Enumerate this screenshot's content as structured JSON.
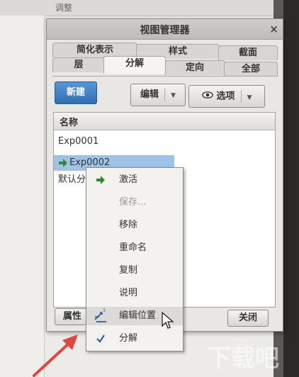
{
  "background": {
    "partial_title": "调整"
  },
  "dialog": {
    "title": "视图管理器",
    "close_glyph": "×",
    "tabs_row1": [
      {
        "label": "简化表示"
      },
      {
        "label": "样式"
      },
      {
        "label": "截面"
      }
    ],
    "tabs_row2": [
      {
        "label": "层"
      },
      {
        "label": "分解"
      },
      {
        "label": "定向"
      },
      {
        "label": "全部"
      }
    ],
    "active_tab": "分解",
    "toolbar": {
      "new_label": "新建",
      "edit_label": "编辑",
      "options_label": "选项",
      "dropdown_glyph": "▼"
    },
    "list": {
      "column_header": "名称",
      "rows": [
        {
          "name": "Exp0001"
        },
        {
          "name": "Exp0002",
          "selected": true
        },
        {
          "name": "默认分"
        }
      ]
    },
    "bottom": {
      "properties_label": "属性",
      "close_label": "关闭"
    }
  },
  "context_menu": {
    "items": [
      {
        "label": "激活",
        "icon": "green-arrow-icon"
      },
      {
        "label": "保存...",
        "disabled": true
      },
      {
        "label": "移除"
      },
      {
        "label": "重命名"
      },
      {
        "label": "复制"
      },
      {
        "label": "说明"
      },
      {
        "label": "编辑位置",
        "icon": "edit-position-icon",
        "hover": true
      },
      {
        "label": "分解",
        "icon": "checkmark-icon",
        "checked": true
      }
    ]
  },
  "watermark": {
    "text": "下载吧"
  },
  "colors": {
    "accent_blue": "#2f6fb1",
    "selection": "#9fc3e7",
    "arrow_red": "#e2453b",
    "active_green": "#2e8b2e"
  }
}
